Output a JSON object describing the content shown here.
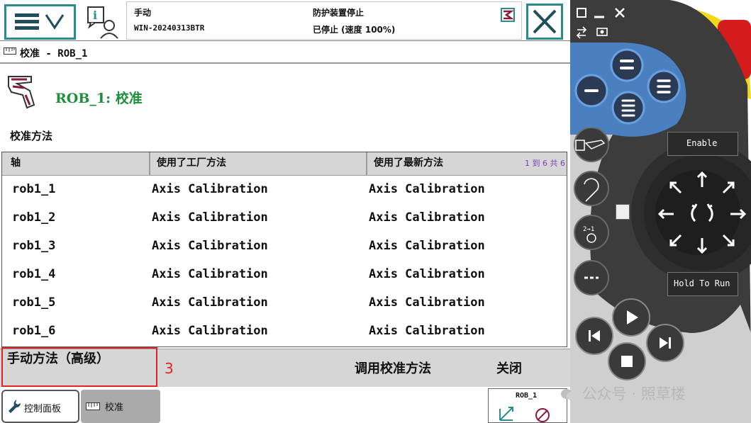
{
  "header": {
    "mode": "手动",
    "controller": "WIN-20240313BTR",
    "state": "防护装置停止",
    "speed": "已停止 (速度 100%)"
  },
  "breadcrumb": {
    "label": "校准 - ROB_1"
  },
  "page": {
    "title": "ROB_1:  校准",
    "section": "校准方法"
  },
  "table": {
    "headers": [
      "轴",
      "使用了工厂方法",
      "使用了最新方法"
    ],
    "page_count": "1 到 6 共 6",
    "rows": [
      {
        "axis": "rob1_1",
        "factory": "Axis Calibration",
        "latest": "Axis Calibration"
      },
      {
        "axis": "rob1_2",
        "factory": "Axis Calibration",
        "latest": "Axis Calibration"
      },
      {
        "axis": "rob1_3",
        "factory": "Axis Calibration",
        "latest": "Axis Calibration"
      },
      {
        "axis": "rob1_4",
        "factory": "Axis Calibration",
        "latest": "Axis Calibration"
      },
      {
        "axis": "rob1_5",
        "factory": "Axis Calibration",
        "latest": "Axis Calibration"
      },
      {
        "axis": "rob1_6",
        "factory": "Axis Calibration",
        "latest": "Axis Calibration"
      }
    ]
  },
  "commands": {
    "manual": "手动方法（高级）",
    "call": "调用校准方法",
    "close": "关闭"
  },
  "annotation": "3",
  "taskbar": {
    "panel": "控制面板",
    "calibration": "校准",
    "quickset_unit": "ROB_1"
  },
  "pendant": {
    "enable": "Enable",
    "hold_to_run": "Hold To Run"
  },
  "watermark": "公众号 · 照草楼",
  "colors": {
    "accent": "#2a8c8c",
    "title_green": "#1e8f3a",
    "highlight": "#e02424",
    "pendant_blue": "#4a7fc0"
  }
}
